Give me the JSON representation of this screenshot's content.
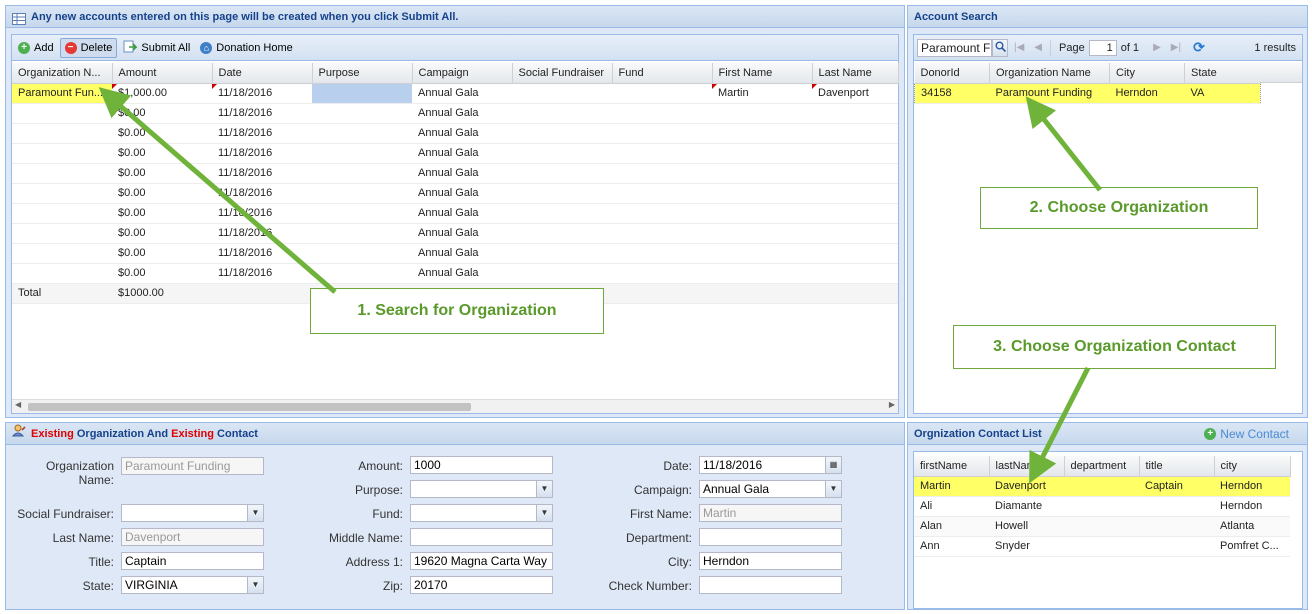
{
  "left_grid": {
    "title": "Any new accounts entered on this page will be created when you click Submit All.",
    "toolbar": {
      "add": "Add",
      "delete": "Delete",
      "submit_all": "Submit All",
      "donation_home": "Donation Home"
    },
    "columns": [
      "Organization N...",
      "Amount",
      "Date",
      "Purpose",
      "Campaign",
      "Social Fundraiser",
      "Fund",
      "First Name",
      "Last Name"
    ],
    "rows": [
      [
        "Paramount Fun...",
        "$1,000.00",
        "11/18/2016",
        "",
        "Annual Gala",
        "",
        "",
        "Martin",
        "Davenport"
      ],
      [
        "",
        "$0.00",
        "11/18/2016",
        "",
        "Annual Gala",
        "",
        "",
        "",
        ""
      ],
      [
        "",
        "$0.00",
        "11/18/2016",
        "",
        "Annual Gala",
        "",
        "",
        "",
        ""
      ],
      [
        "",
        "$0.00",
        "11/18/2016",
        "",
        "Annual Gala",
        "",
        "",
        "",
        ""
      ],
      [
        "",
        "$0.00",
        "11/18/2016",
        "",
        "Annual Gala",
        "",
        "",
        "",
        ""
      ],
      [
        "",
        "$0.00",
        "11/18/2016",
        "",
        "Annual Gala",
        "",
        "",
        "",
        ""
      ],
      [
        "",
        "$0.00",
        "11/18/2016",
        "",
        "Annual Gala",
        "",
        "",
        "",
        ""
      ],
      [
        "",
        "$0.00",
        "11/18/2016",
        "",
        "Annual Gala",
        "",
        "",
        "",
        ""
      ],
      [
        "",
        "$0.00",
        "11/18/2016",
        "",
        "Annual Gala",
        "",
        "",
        "",
        ""
      ],
      [
        "",
        "$0.00",
        "11/18/2016",
        "",
        "Annual Gala",
        "",
        "",
        "",
        ""
      ]
    ],
    "total_label": "Total",
    "total_value": "$1000.00"
  },
  "account_search": {
    "title": "Account Search",
    "search_value": "Paramount F",
    "page_label": "Page",
    "page_value": "1",
    "of_label": "of 1",
    "results": "1 results",
    "columns": [
      "DonorId",
      "Organization Name",
      "City",
      "State"
    ],
    "rows": [
      [
        "34158",
        "Paramount Funding",
        "Herndon",
        "VA"
      ]
    ]
  },
  "form": {
    "title_existing1": "Existing",
    "title_mid": " Organization And ",
    "title_existing2": "Existing",
    "title_end": " Contact",
    "org_name_label": "Organization Name:",
    "org_name_value": "Paramount Funding",
    "social_fundraiser_label": "Social Fundraiser:",
    "social_fundraiser_value": "",
    "last_name_label": "Last Name:",
    "last_name_value": "Davenport",
    "title_label": "Title:",
    "title_value": "Captain",
    "state_label": "State:",
    "state_value": "VIRGINIA",
    "amount_label": "Amount:",
    "amount_value": "1000",
    "purpose_label": "Purpose:",
    "purpose_value": "",
    "fund_label": "Fund:",
    "fund_value": "",
    "middle_name_label": "Middle Name:",
    "middle_name_value": "",
    "address1_label": "Address 1:",
    "address1_value": "19620 Magna Carta Way",
    "zip_label": "Zip:",
    "zip_value": "20170",
    "date_label": "Date:",
    "date_value": "11/18/2016",
    "campaign_label": "Campaign:",
    "campaign_value": "Annual Gala",
    "first_name_label": "First Name:",
    "first_name_value": "Martin",
    "department_label": "Department:",
    "department_value": "",
    "city_label": "City:",
    "city_value": "Herndon",
    "check_number_label": "Check Number:",
    "check_number_value": ""
  },
  "contact_list": {
    "title": "Orgnization Contact List",
    "new_contact": "New Contact",
    "columns": [
      "firstName",
      "lastName",
      "department",
      "title",
      "city"
    ],
    "rows": [
      [
        "Martin",
        "Davenport",
        "",
        "Captain",
        "Herndon"
      ],
      [
        "Ali",
        "Diamante",
        "",
        "",
        "Herndon"
      ],
      [
        "Alan",
        "Howell",
        "",
        "",
        "Atlanta"
      ],
      [
        "Ann",
        "Snyder",
        "",
        "",
        "Pomfret C..."
      ]
    ]
  },
  "callouts": {
    "step1": "1. Search for Organization",
    "step2": "2. Choose Organization",
    "step3": "3. Choose Organization Contact"
  },
  "colors": {
    "callout_green": "#5a9a2a",
    "highlight": "#ffff66",
    "existing_red": "#e00000"
  }
}
